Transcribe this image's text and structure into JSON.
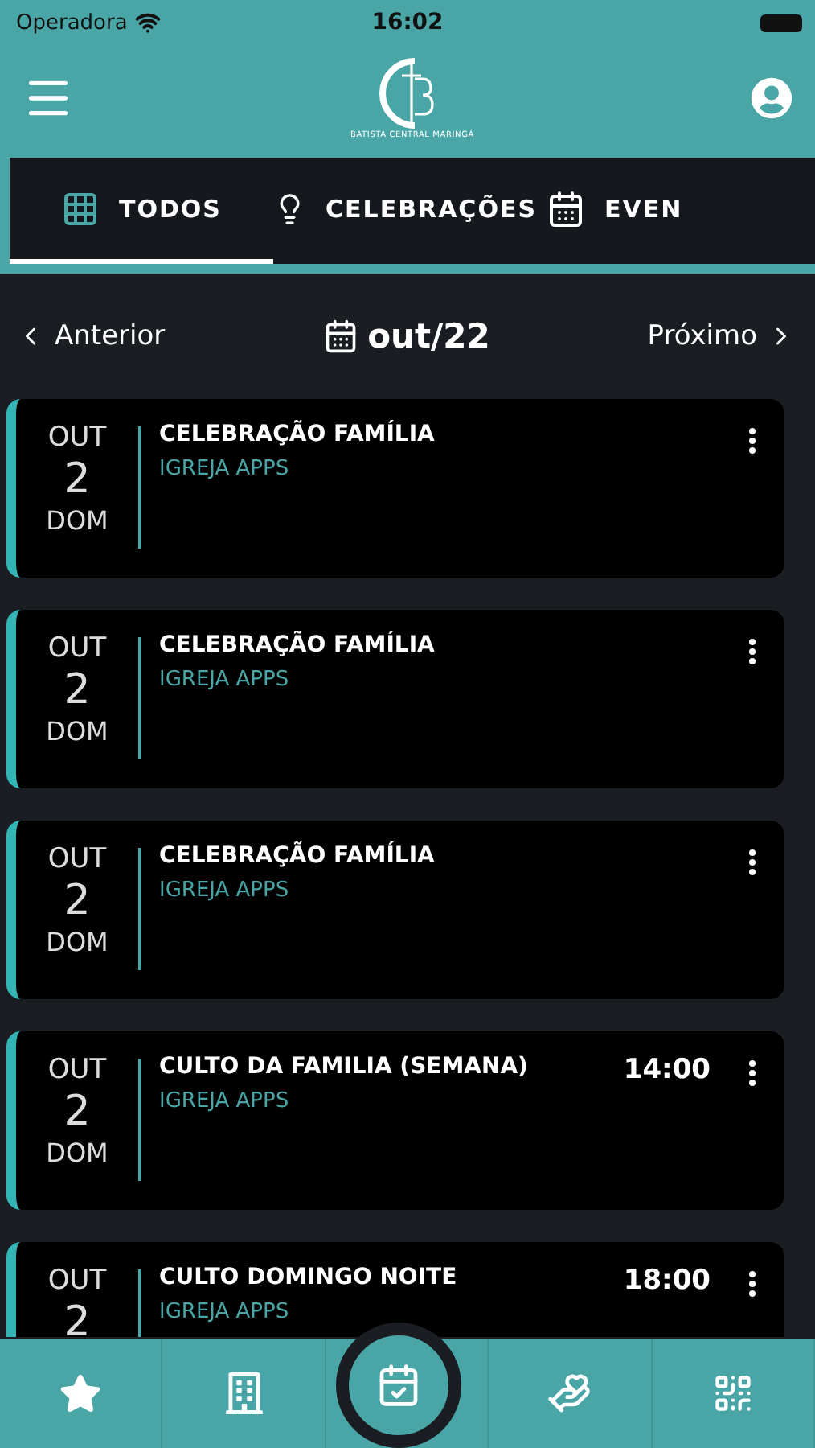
{
  "status_bar": {
    "carrier": "Operadora",
    "time": "16:02"
  },
  "header": {
    "logo_text": "BATISTA CENTRAL MARINGÁ"
  },
  "tabs": [
    {
      "label": "TODOS",
      "kind": "grid",
      "selected": true
    },
    {
      "label": "CELEBRAÇÕES",
      "kind": "bulb",
      "selected": false
    },
    {
      "label": "EVEN",
      "kind": "calendar",
      "selected": false
    }
  ],
  "month_nav": {
    "previous": "Anterior",
    "month": "out/22",
    "next": "Próximo"
  },
  "events": [
    {
      "month": "OUT",
      "day": "2",
      "weekday": "DOM",
      "title": "CELEBRAÇÃO FAMÍLIA",
      "organizer": "IGREJA APPS"
    },
    {
      "month": "OUT",
      "day": "2",
      "weekday": "DOM",
      "title": "CELEBRAÇÃO FAMÍLIA",
      "organizer": "IGREJA APPS"
    },
    {
      "month": "OUT",
      "day": "2",
      "weekday": "DOM",
      "title": "CELEBRAÇÃO FAMÍLIA",
      "organizer": "IGREJA APPS"
    },
    {
      "month": "OUT",
      "day": "2",
      "weekday": "DOM",
      "title": "CULTO DA FAMILIA (SEMANA)",
      "organizer": "IGREJA APPS",
      "time": "14:00"
    },
    {
      "month": "OUT",
      "day": "2",
      "title": "CULTO DOMINGO NOITE",
      "organizer": "IGREJA APPS",
      "time": "18:00"
    }
  ],
  "bottom_nav": [
    {
      "kind": "star",
      "selected": false
    },
    {
      "kind": "building",
      "selected": false
    },
    {
      "kind": "calendar-check",
      "selected": true
    },
    {
      "kind": "hand-heart",
      "selected": false
    },
    {
      "kind": "qr",
      "selected": false
    }
  ]
}
